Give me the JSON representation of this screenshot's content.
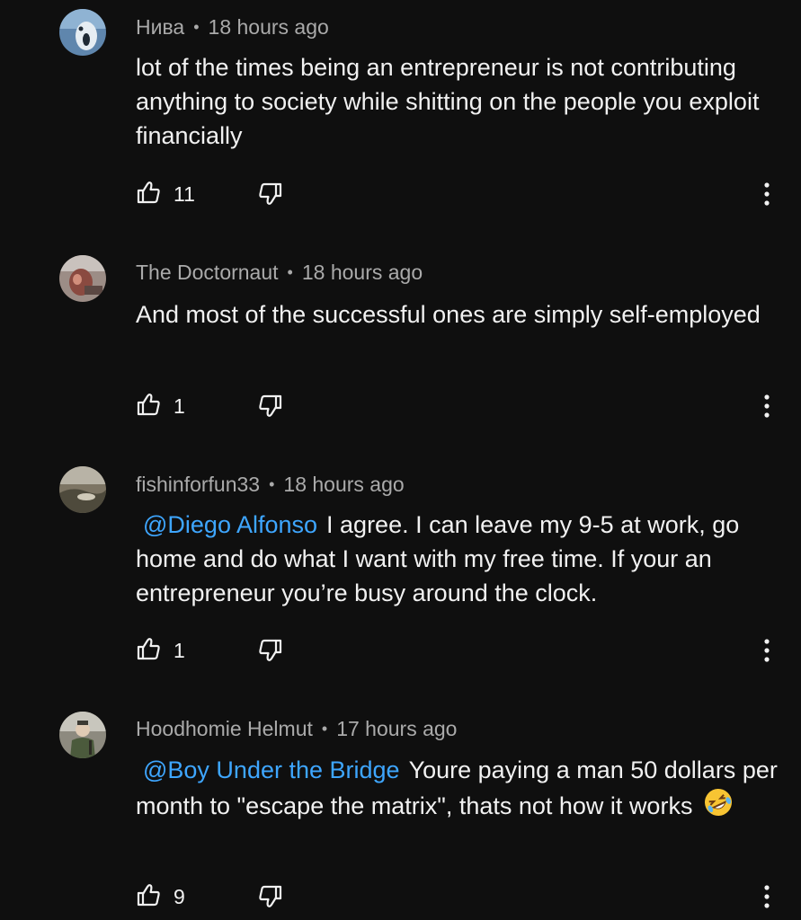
{
  "comments": [
    {
      "author": "Нива",
      "time": "18 hours ago",
      "text": "lot of the times being an entrepreneur is not contributing anything to society while shitting on the people you exploit financially",
      "mention": "",
      "likes": "11",
      "avatar_color": "#6f93b8"
    },
    {
      "author": "The Doctornaut",
      "time": "18 hours ago",
      "text": "And most of the successful ones are simply self-employed",
      "mention": "",
      "likes": "1",
      "avatar_color": "#7a5a52"
    },
    {
      "author": "fishinforfun33",
      "time": "18 hours ago",
      "mention": "@Diego Alfonso",
      "text": "I agree. I can leave my 9-5 at work, go home and do what I want with my free time. If your an entrepreneur you’re busy around the clock.",
      "likes": "1",
      "avatar_color": "#8a7f6a"
    },
    {
      "author": "Hoodhomie Helmut",
      "time": "17 hours ago",
      "mention": "@Boy Under the Bridge",
      "text": "Youre paying a man 50 dollars per month to \"escape the matrix\", thats not how it works",
      "emoji": "rolling-on-floor-laughing-emoji",
      "likes": "9",
      "avatar_color": "#6d6a5c"
    }
  ],
  "colors": {
    "background": "#0f0f0f",
    "text": "#f1f1f1",
    "secondary_text": "#aaaaaa",
    "mention": "#3ea6ff"
  },
  "icons": {
    "like": "thumbs-up-icon",
    "dislike": "thumbs-down-icon",
    "more": "more-vertical-icon"
  }
}
